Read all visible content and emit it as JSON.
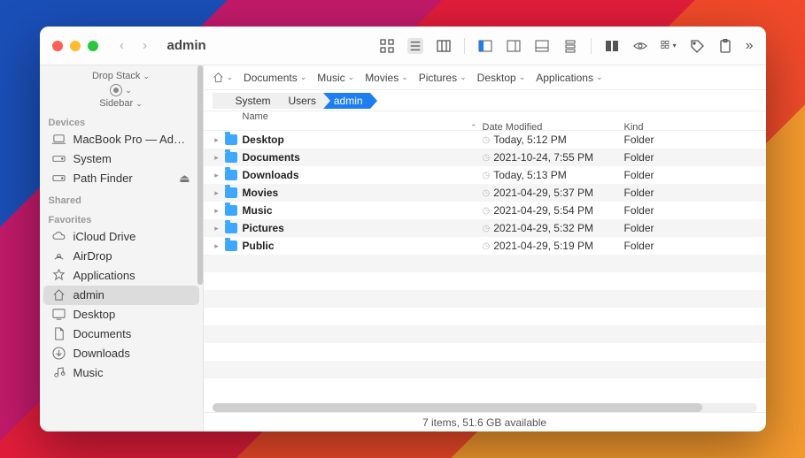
{
  "window": {
    "title": "admin"
  },
  "sidebar": {
    "dropstack": "Drop Stack",
    "sidebar_label": "Sidebar",
    "sections": {
      "devices": "Devices",
      "shared": "Shared",
      "favorites": "Favorites"
    },
    "devices": [
      {
        "label": "MacBook Pro — Ad…",
        "icon": "laptop"
      },
      {
        "label": "System",
        "icon": "disk"
      },
      {
        "label": "Path Finder",
        "icon": "disk",
        "eject": true
      }
    ],
    "favorites": [
      {
        "label": "iCloud Drive",
        "icon": "cloud"
      },
      {
        "label": "AirDrop",
        "icon": "airdrop"
      },
      {
        "label": "Applications",
        "icon": "apps"
      },
      {
        "label": "admin",
        "icon": "home",
        "selected": true
      },
      {
        "label": "Desktop",
        "icon": "desktop"
      },
      {
        "label": "Documents",
        "icon": "doc"
      },
      {
        "label": "Downloads",
        "icon": "download"
      },
      {
        "label": "Music",
        "icon": "music"
      }
    ]
  },
  "pathbar": {
    "items": [
      "Documents",
      "Music",
      "Movies",
      "Pictures",
      "Desktop",
      "Applications"
    ]
  },
  "breadcrumb": {
    "segments": [
      "System",
      "Users",
      "admin"
    ]
  },
  "columns": {
    "name": "Name",
    "date": "Date Modified",
    "kind": "Kind"
  },
  "rows": [
    {
      "name": "Desktop",
      "date": "Today, 5:12 PM",
      "kind": "Folder"
    },
    {
      "name": "Documents",
      "date": "2021-10-24, 7:55 PM",
      "kind": "Folder"
    },
    {
      "name": "Downloads",
      "date": "Today, 5:13 PM",
      "kind": "Folder"
    },
    {
      "name": "Movies",
      "date": "2021-04-29, 5:37 PM",
      "kind": "Folder"
    },
    {
      "name": "Music",
      "date": "2021-04-29, 5:54 PM",
      "kind": "Folder"
    },
    {
      "name": "Pictures",
      "date": "2021-04-29, 5:32 PM",
      "kind": "Folder"
    },
    {
      "name": "Public",
      "date": "2021-04-29, 5:19 PM",
      "kind": "Folder"
    }
  ],
  "status": "7 items, 51.6 GB available"
}
